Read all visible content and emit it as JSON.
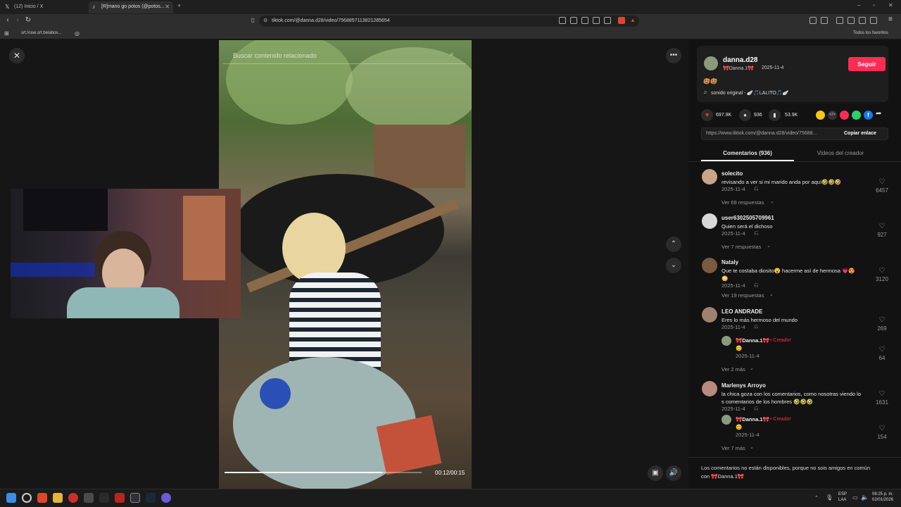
{
  "browser": {
    "tabs": [
      {
        "title": "(12) Inicio / X"
      },
      {
        "title": "[R]mano go potos (@potos..."
      }
    ],
    "url": "tiktok.com/@danna.d28/video/7568857113821285654",
    "bookmarks": {
      "item1": "srt://use.srt.belabox...",
      "all_favs": "Todos los favoritos"
    }
  },
  "search": {
    "placeholder": "Buscar contenido relacionado"
  },
  "video": {
    "time": "00:12/00:15",
    "progress": 0.8
  },
  "author": {
    "username": "danna.d28",
    "display": "🎀Danna.1🎀",
    "date": "2025-11-4",
    "follow_label": "Seguir",
    "caption": "🥵🥵",
    "sound": "sonido original - 🪽🎵LALITO🎵🪽"
  },
  "stats": {
    "likes": "697.9K",
    "comments": "936",
    "saves": "53.9K"
  },
  "link": {
    "url": "https://www.tiktok.com/@danna.d28/video/75688...",
    "copy_label": "Copiar enlace"
  },
  "tabs": {
    "comments": "Comentarios (936)",
    "creator_videos": "Videos del creador"
  },
  "comments": [
    {
      "user": "solecito",
      "text": "revisando a ver si mi marido anda por aquí🤣🤣🤣",
      "date": "2025-11-4",
      "likes": "6457",
      "replies": "Ver 69 respuestas"
    },
    {
      "user": "user6302505709961",
      "text": "Quien será el dichoso",
      "date": "2025-11-4",
      "likes": "927",
      "replies": "Ver 7 respuestas"
    },
    {
      "user": "Nataly",
      "text": "Que te costaba diosito😮 hacerme así de hermosa 💗😍",
      "text2": "😳",
      "date": "2025-11-4",
      "likes": "3120",
      "replies": "Ver 19 respuestas"
    },
    {
      "user": "LEO ANDRADE",
      "text": "Eres lo más hermoso del mundo",
      "date": "2025-11-4",
      "likes": "269",
      "reply": {
        "user": "🎀Danna.1🎀",
        "badge": "Creador",
        "text": "😊",
        "date": "2025-11-4",
        "likes": "64"
      },
      "replies": "Ver 2 más"
    },
    {
      "user": "Marlenys Arroyo",
      "text": "la chica goza con los comentarios, como nosotras viendo lo",
      "text2": "s comentarios de los hombres 🤣🤣🤣",
      "date": "2025-11-4",
      "likes": "1631",
      "reply": {
        "user": "🎀Danna.1🎀",
        "badge": "Creador",
        "text": "😊",
        "date": "2025-11-4",
        "likes": "154"
      },
      "replies": "Ver 7 más"
    }
  ],
  "footer_note": {
    "line1": "Los comentarios no están disponibles, porque no sois amigos en común",
    "line2": "con 🎀Danna.1🎀"
  },
  "taskbar": {
    "lang1": "ESP",
    "lang2": "LAA",
    "time": "08:25 p. m.",
    "date": "02/01/2026"
  },
  "colors": {
    "accent": "#fe2c55",
    "bg": "#121212"
  }
}
